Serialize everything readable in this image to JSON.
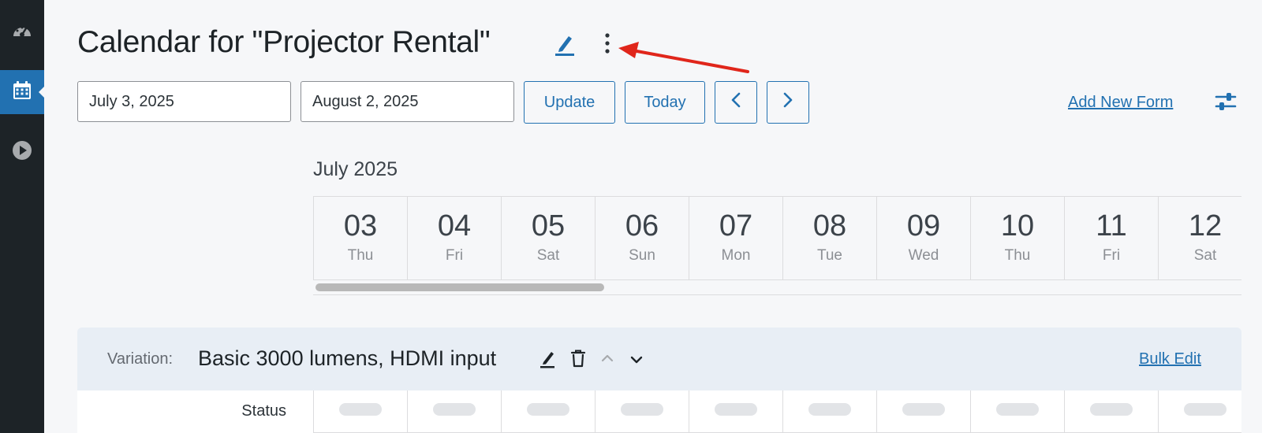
{
  "sidebar": {
    "items": [
      {
        "icon": "dashboard-gauge-icon",
        "active": false
      },
      {
        "icon": "calendar-icon",
        "active": true
      },
      {
        "icon": "play-circle-icon",
        "active": false
      }
    ]
  },
  "header": {
    "title": "Calendar for \"Projector Rental\"",
    "edit_icon": "pencil-icon",
    "more_icon": "kebab-menu-icon",
    "annotation_color": "#e0261b"
  },
  "toolbar": {
    "start_date": "July 3, 2025",
    "end_date": "August 2, 2025",
    "update_label": "Update",
    "today_label": "Today",
    "add_new_form_label": "Add New Form",
    "settings_icon": "sliders-icon"
  },
  "calendar": {
    "month_label": "July 2025",
    "days": [
      {
        "num": "03",
        "name": "Thu"
      },
      {
        "num": "04",
        "name": "Fri"
      },
      {
        "num": "05",
        "name": "Sat"
      },
      {
        "num": "06",
        "name": "Sun"
      },
      {
        "num": "07",
        "name": "Mon"
      },
      {
        "num": "08",
        "name": "Tue"
      },
      {
        "num": "09",
        "name": "Wed"
      },
      {
        "num": "10",
        "name": "Thu"
      },
      {
        "num": "11",
        "name": "Fri"
      },
      {
        "num": "12",
        "name": "Sat"
      }
    ]
  },
  "variation": {
    "label": "Variation:",
    "title": "Basic 3000 lumens, HDMI input",
    "bulk_edit_label": "Bulk Edit",
    "status_label": "Status"
  },
  "colors": {
    "accent": "#2271b1",
    "sidebar_bg": "#1d2327",
    "page_bg": "#f6f7f9"
  }
}
